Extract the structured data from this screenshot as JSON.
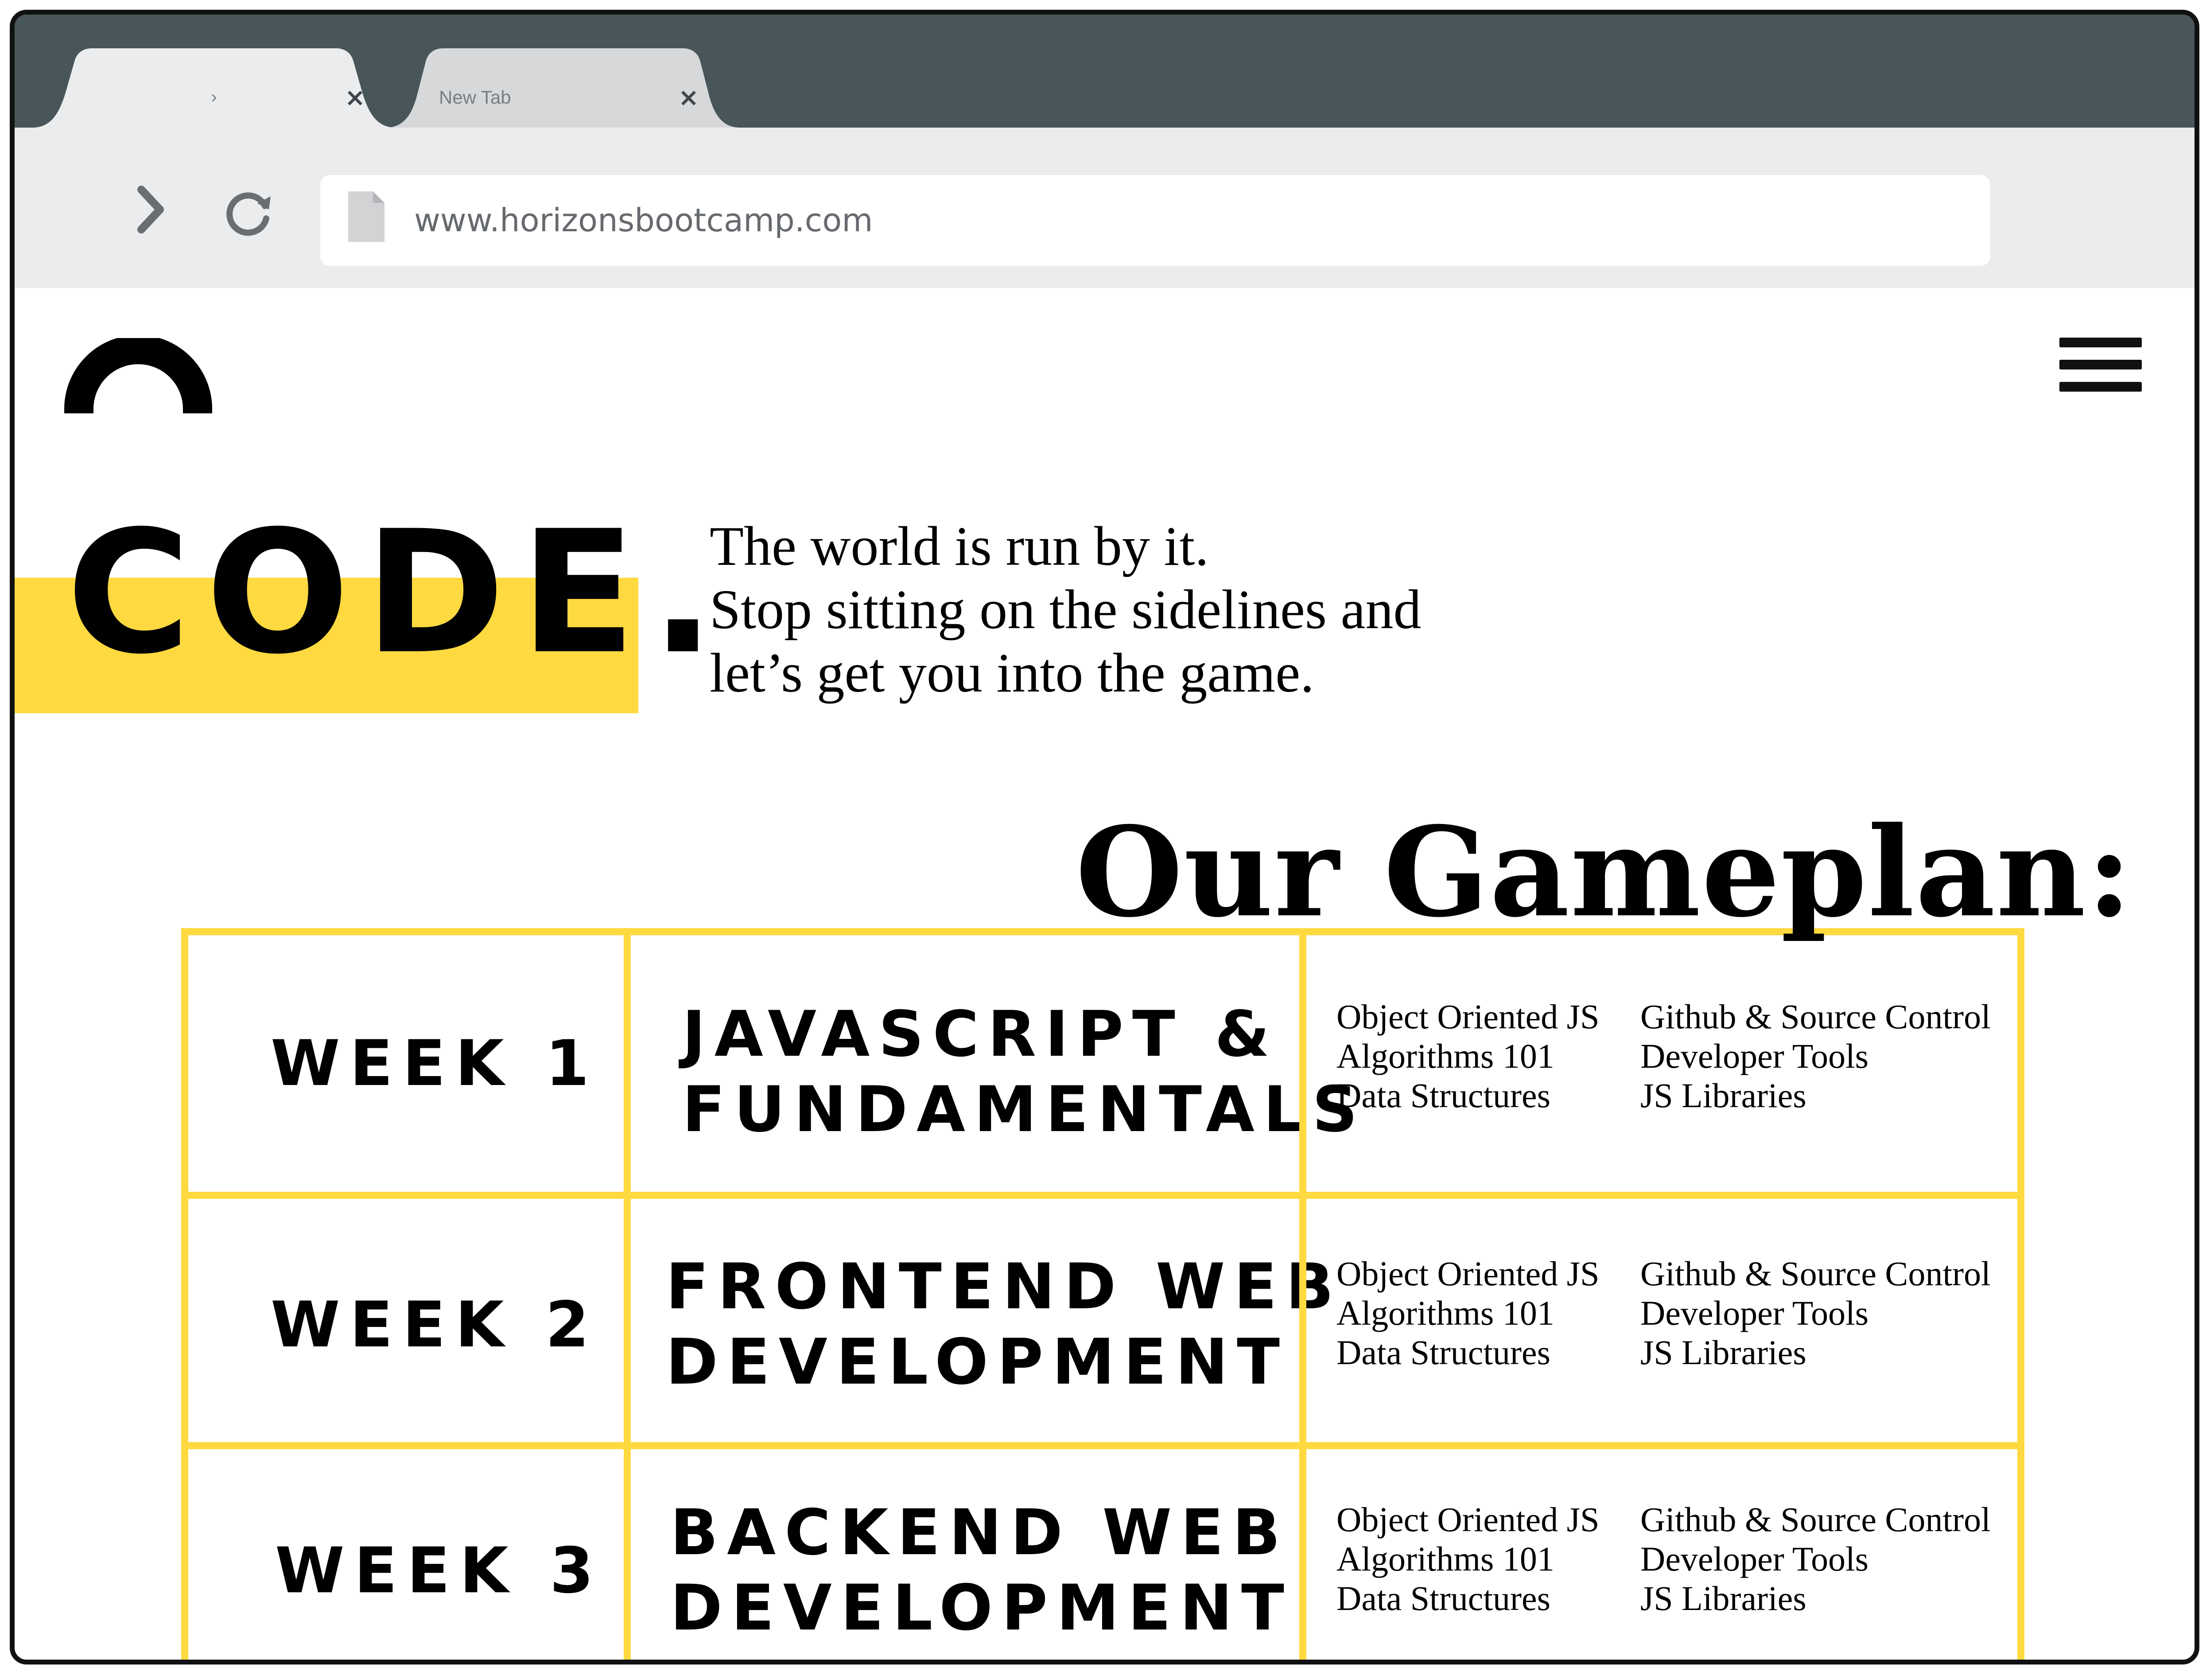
{
  "browser": {
    "tabs": [
      {
        "label": "›",
        "close": "×"
      },
      {
        "label": "New Tab",
        "close": "×"
      }
    ],
    "address": "www.horizonsbootcamp.com"
  },
  "hero": {
    "title": "CODE.",
    "tagline": [
      "The world is run by it.",
      "Stop sitting on the sidelines and",
      "let’s get you into the game."
    ]
  },
  "gameplan": {
    "title": "Our Gameplan:",
    "rows": [
      {
        "week": "WEEK 1",
        "topic": [
          "JAVASCRIPT &",
          "FUNDAMENTALS"
        ],
        "items_left": [
          "Object Oriented JS",
          "Algorithms 101",
          "Data Structures"
        ],
        "items_right": [
          "Github & Source Control",
          "Developer Tools",
          "JS Libraries"
        ]
      },
      {
        "week": "WEEK 2",
        "topic": [
          "FRONTEND WEB",
          "DEVELOPMENT"
        ],
        "items_left": [
          "Object Oriented JS",
          "Algorithms 101",
          "Data Structures"
        ],
        "items_right": [
          "Github & Source Control",
          "Developer Tools",
          "JS Libraries"
        ]
      },
      {
        "week": "WEEK 3",
        "topic": [
          "BACKEND WEB",
          "DEVELOPMENT"
        ],
        "items_left": [
          "Object Oriented JS",
          "Algorithms 101",
          "Data Structures"
        ],
        "items_right": [
          "Github & Source Control",
          "Developer Tools",
          "JS Libraries"
        ]
      }
    ]
  },
  "colors": {
    "accent": "#ffd940",
    "tabbar": "#485559",
    "toolbar": "#ebeced"
  }
}
